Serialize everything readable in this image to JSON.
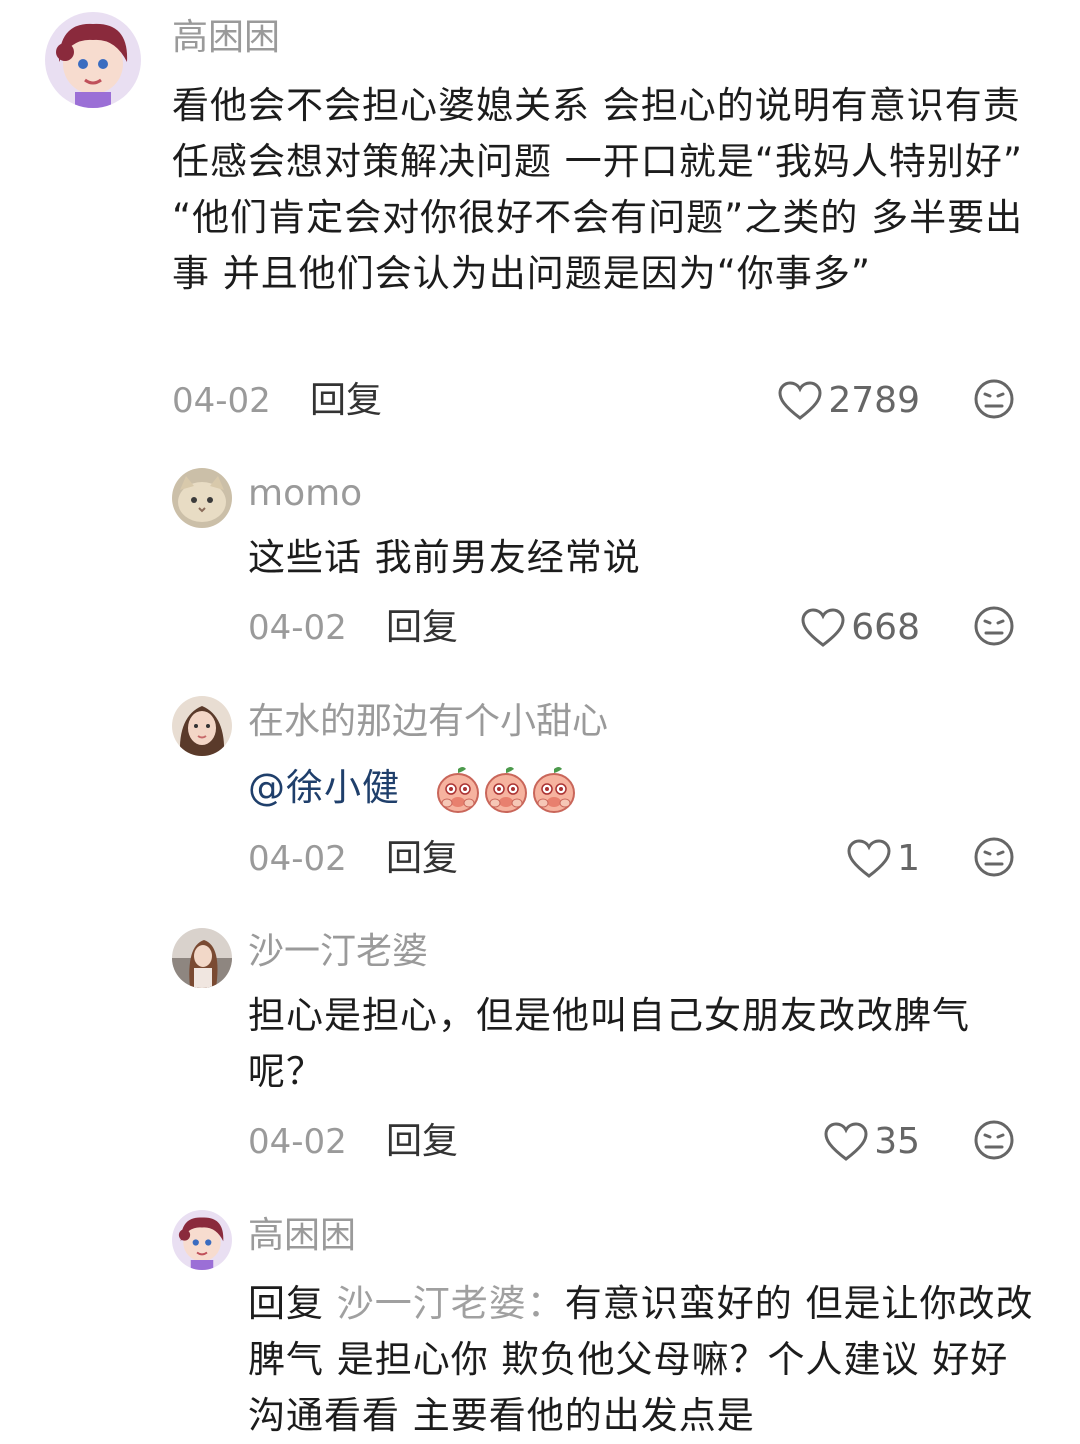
{
  "comments": [
    {
      "username": "高困困",
      "text": "看他会不会担心婆媳关系 会担心的说明有意识有责任感会想对策解决问题  一开口就是“我妈人特别好” “他们肯定会对你很好不会有问题”之类的 多半要出事 并且他们会认为出问题是因为“你事多”",
      "date": "04-02",
      "reply_label": "回复",
      "likes": "2789"
    },
    {
      "username": "momo",
      "text": "这些话 我前男友经常说",
      "date": "04-02",
      "reply_label": "回复",
      "likes": "668"
    },
    {
      "username": "在水的那边有个小甜心",
      "mention": "@徐小健",
      "emoji_count": 3,
      "date": "04-02",
      "reply_label": "回复",
      "likes": "1"
    },
    {
      "username": "沙一汀老婆",
      "text": "担心是担心，但是他叫自己女朋友改改脾气呢？",
      "date": "04-02",
      "reply_label": "回复",
      "likes": "35"
    },
    {
      "username": "高困困",
      "reply_prefix": "回复 ",
      "reply_to": "沙一汀老婆：",
      "text": "有意识蛮好的 但是让你改改脾气 是担心你 欺负他父母嘛？个人建议 好好沟通看看 主要看他的出发点是"
    }
  ],
  "icons": {
    "like": "heart-outline-icon",
    "dislike": "neutral-face-icon"
  },
  "colors": {
    "meta_gray": "#9a9a9a",
    "mention_blue": "#1f3f6b"
  }
}
